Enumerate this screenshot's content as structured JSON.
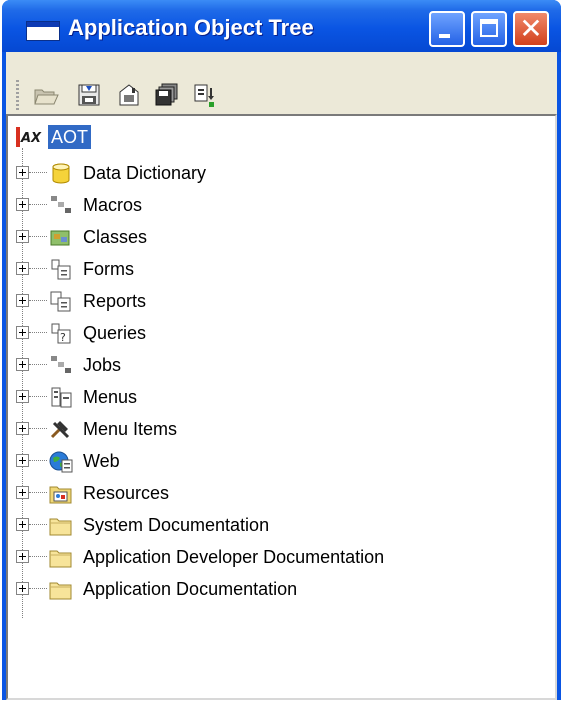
{
  "window": {
    "title": "Application Object Tree",
    "controls": [
      "minimize",
      "maximize",
      "close"
    ]
  },
  "toolbar": {
    "buttons": [
      {
        "icon": "open-folder-icon"
      },
      {
        "icon": "import-icon"
      },
      {
        "icon": "properties-icon"
      },
      {
        "icon": "save-all-icon"
      },
      {
        "icon": "compile-icon"
      }
    ]
  },
  "tree": {
    "root": {
      "label": "AOT",
      "selected": true,
      "icon": "ax-logo-icon"
    },
    "nodes": [
      {
        "label": "Data Dictionary",
        "icon": "database-icon"
      },
      {
        "label": "Macros",
        "icon": "macros-icon"
      },
      {
        "label": "Classes",
        "icon": "classes-icon"
      },
      {
        "label": "Forms",
        "icon": "forms-icon"
      },
      {
        "label": "Reports",
        "icon": "reports-icon"
      },
      {
        "label": "Queries",
        "icon": "queries-icon"
      },
      {
        "label": "Jobs",
        "icon": "jobs-icon"
      },
      {
        "label": "Menus",
        "icon": "menus-icon"
      },
      {
        "label": "Menu Items",
        "icon": "tools-icon"
      },
      {
        "label": "Web",
        "icon": "web-globe-icon"
      },
      {
        "label": "Resources",
        "icon": "resources-icon"
      },
      {
        "label": "System Documentation",
        "icon": "folder-icon"
      },
      {
        "label": "Application Developer Documentation",
        "icon": "folder-icon"
      },
      {
        "label": "Application Documentation",
        "icon": "folder-icon"
      }
    ]
  },
  "colors": {
    "titlebar": "#0a55e3",
    "selection": "#316ac5",
    "close_button": "#d2401c",
    "client_bg": "#ece9d8"
  }
}
